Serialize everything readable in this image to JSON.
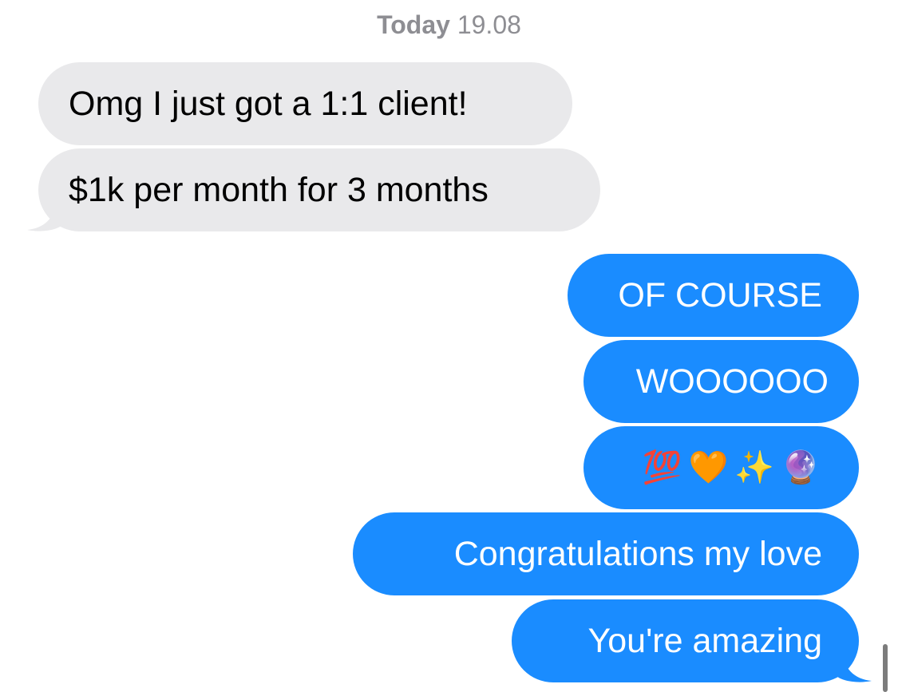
{
  "timestamp": {
    "day": "Today",
    "time": "19.08"
  },
  "messages": {
    "incoming": [
      "Omg I just got a 1:1 client!",
      "$1k per month for 3 months"
    ],
    "outgoing": [
      "OF COURSE",
      "WOOOOOO",
      "💯🧡✨🔮",
      "Congratulations my love",
      "You're amazing"
    ]
  },
  "colors": {
    "incoming_bubble": "#e9e9eb",
    "outgoing_bubble": "#1a8cff",
    "timestamp_text": "#8e8e93"
  }
}
